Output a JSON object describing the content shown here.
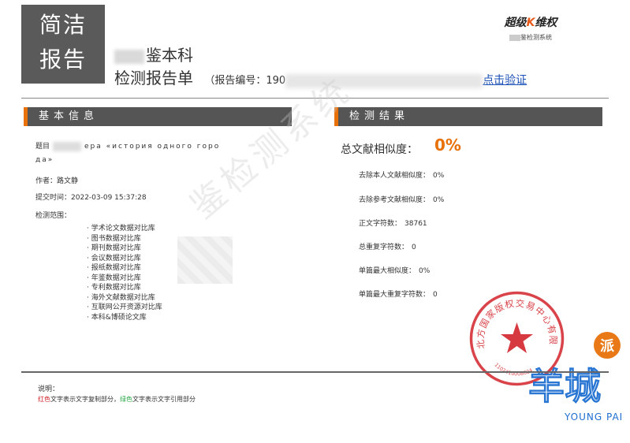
{
  "header": {
    "badge_line1": "简洁",
    "badge_line2": "报告",
    "title_line1": "鉴本科",
    "title_line2": "检测报告单",
    "report_no_label": "（报告编号：190",
    "verify_link": "点击验证"
  },
  "logo": {
    "brand_left": "超级",
    "brand_k": "K",
    "brand_right": "维权",
    "subtitle": "鉴检测系统"
  },
  "sections": {
    "basic_info": "基本信息",
    "results": "检测结果"
  },
  "basic": {
    "title_label": "题目",
    "title_value_line1": "ера «история одного горо",
    "title_value_line2": "да»",
    "author_label": "作者：",
    "author_value": "路文静",
    "submit_label": "提交时间：",
    "submit_value": "2022-03-09 15:37:28",
    "scope_label": "检测范围：",
    "scope_items": [
      "学术论文数据对比库",
      "图书数据对比库",
      "期刊数据对比库",
      "会议数据对比库",
      "报纸数据对比库",
      "年鉴数据对比库",
      "专利数据对比库",
      "海外文献数据对比库",
      "互联网公开资源对比库",
      "本科&博硕论文库"
    ]
  },
  "results": {
    "total_label": "总文献相似度：",
    "total_value": "0%",
    "stats": [
      {
        "label": "去除本人文献相似度：",
        "value": "0%"
      },
      {
        "label": "去除参考文献相似度：",
        "value": "0%"
      },
      {
        "label": "正文字符数：",
        "value": "38761"
      },
      {
        "label": "总重复字符数：",
        "value": "0"
      },
      {
        "label": "单篇最大相似度：",
        "value": "0%"
      },
      {
        "label": "单篇最大重复字符数：",
        "value": "0"
      }
    ]
  },
  "watermark": "鉴检测系统",
  "notes": {
    "title": "说明：",
    "red_word": "红色",
    "red_desc": "文字表示文字复制部分，",
    "green_word": "绿色",
    "green_desc": "文字表示文字引用部分"
  },
  "seal": {
    "text": "北方国家版权交易中心有限公司",
    "number": "1102410008024"
  },
  "overlay_logo": {
    "main": "羊城",
    "tag": "派",
    "sub": "YOUNG PAI"
  },
  "colors": {
    "accent": "#e8710a",
    "header_bar": "#555555",
    "seal_red": "#d2232a",
    "link_blue": "#1a4fb5",
    "brand_blue": "#1f6fd1"
  }
}
